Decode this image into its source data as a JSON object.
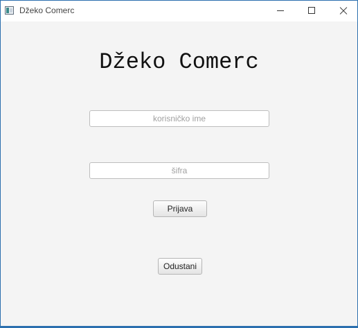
{
  "window": {
    "title": "Džeko Comerc",
    "app_icon": "java-app-icon",
    "controls": {
      "minimize": "minimize-icon",
      "maximize": "maximize-icon",
      "close": "close-icon"
    }
  },
  "login": {
    "heading": "Džeko Comerc",
    "username": {
      "value": "",
      "placeholder": "korisničko ime"
    },
    "password": {
      "value": "",
      "placeholder": "šifra"
    },
    "login_label": "Prijava",
    "cancel_label": "Odustani"
  },
  "colors": {
    "window_background": "#f4f4f4",
    "titlebar_background": "#ffffff",
    "window_border": "#2b6fae"
  }
}
